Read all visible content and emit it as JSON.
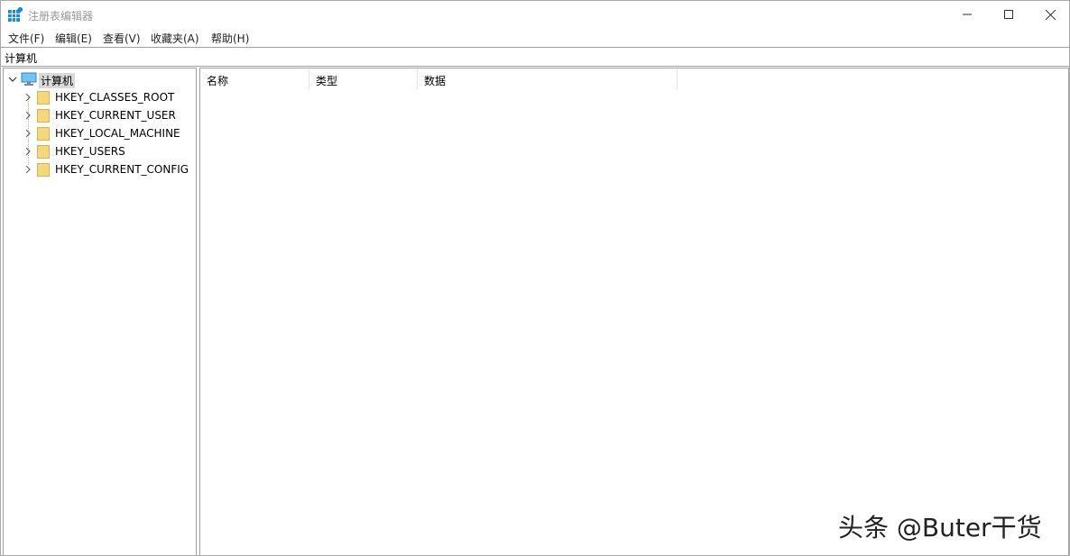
{
  "window": {
    "title": "注册表编辑器",
    "icon": "regedit-icon"
  },
  "controls": {
    "minimize": "minimize-icon",
    "maximize": "maximize-icon",
    "close": "close-icon"
  },
  "menu": [
    {
      "label": "文件(F)"
    },
    {
      "label": "编辑(E)"
    },
    {
      "label": "查看(V)"
    },
    {
      "label": "收藏夹(A)"
    },
    {
      "label": "帮助(H)"
    }
  ],
  "address": {
    "path": "计算机"
  },
  "tree": {
    "root": {
      "label": "计算机",
      "icon": "computer-icon",
      "expanded": true
    },
    "items": [
      {
        "label": "HKEY_CLASSES_ROOT",
        "icon": "folder-icon"
      },
      {
        "label": "HKEY_CURRENT_USER",
        "icon": "folder-icon"
      },
      {
        "label": "HKEY_LOCAL_MACHINE",
        "icon": "folder-icon"
      },
      {
        "label": "HKEY_USERS",
        "icon": "folder-icon"
      },
      {
        "label": "HKEY_CURRENT_CONFIG",
        "icon": "folder-icon"
      }
    ]
  },
  "list": {
    "columns": [
      {
        "label": "名称"
      },
      {
        "label": "类型"
      },
      {
        "label": "数据"
      }
    ]
  },
  "watermark": {
    "text": "头条 @Buter干货"
  },
  "colors": {
    "folder": "#f5d77a",
    "folder_edge": "#d8b450",
    "selection": "#d9d9d9",
    "border": "#a0a0a0"
  }
}
